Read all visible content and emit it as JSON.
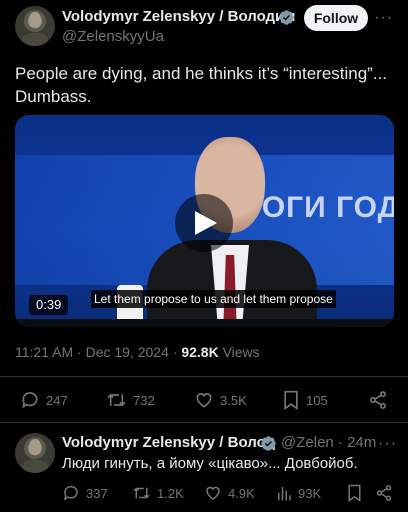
{
  "main_tweet": {
    "author_name": "Volodymyr Zelenskyy / Володим",
    "handle": "@ZelenskyyUa",
    "follow_label": "Follow",
    "more_label": "···",
    "text_line1": "People are dying, and he thinks it’s “interesting”...",
    "text_line2": "Dumbass.",
    "video": {
      "duration": "0:39",
      "caption": "Let them propose to us and let them propose",
      "background_text": "ТОГИ ГОД"
    },
    "time": "11:21 AM",
    "separator": " · ",
    "date": "Dec 19, 2024",
    "views_count": "92.8K",
    "views_label": " Views",
    "actions": {
      "replies": "247",
      "reposts": "732",
      "likes": "3.5K",
      "bookmarks": "105"
    }
  },
  "reply_tweet": {
    "author_name": "Volodymyr Zelenskyy / Волод",
    "handle": "@Zelen",
    "separator": " · ",
    "age": "24m",
    "more_label": "···",
    "text": "Люди гинуть, а йому «цікаво»... Довбойоб.",
    "actions": {
      "replies": "337",
      "reposts": "1.2K",
      "likes": "4.9K",
      "views": "93K"
    }
  },
  "colors": {
    "background": "#000000",
    "text": "#e7e9ea",
    "muted": "#71767b",
    "verified": "#829aab",
    "divider": "#2f3336"
  }
}
